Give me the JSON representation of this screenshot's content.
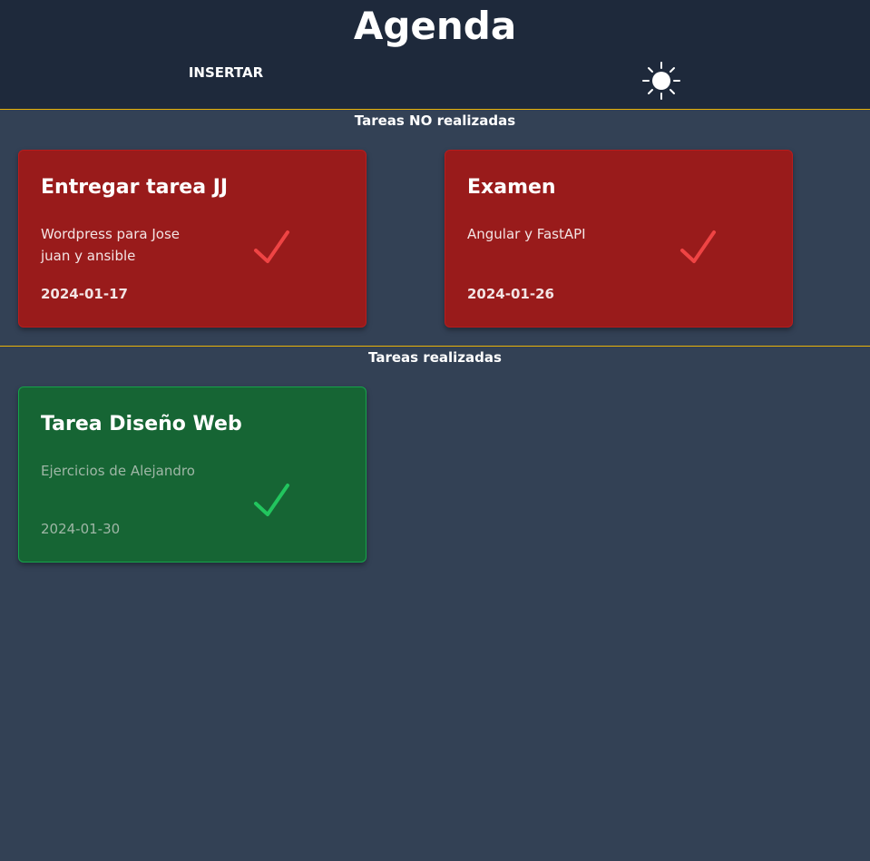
{
  "header": {
    "title": "Agenda",
    "insert_label": "INSERTAR",
    "theme_icon": "sun-icon"
  },
  "sections": {
    "pending_title": "Tareas NO realizadas",
    "done_title": "Tareas realizadas"
  },
  "tasks_pending": [
    {
      "title": "Entregar tarea JJ",
      "description": "Wordpress para Jose juan y ansible",
      "date": "2024-01-17"
    },
    {
      "title": "Examen",
      "description": "Angular y FastAPI",
      "date": "2024-01-26"
    }
  ],
  "tasks_done": [
    {
      "title": "Tarea Diseño Web",
      "description": "Ejercicios de Alejandro",
      "date": "2024-01-30"
    }
  ],
  "colors": {
    "background": "#334155",
    "header": "#1e293b",
    "divider": "#eab308",
    "pending_card": "#991b1b",
    "done_card": "#166534",
    "pending_check": "#ef4444",
    "done_check": "#22c55e"
  }
}
